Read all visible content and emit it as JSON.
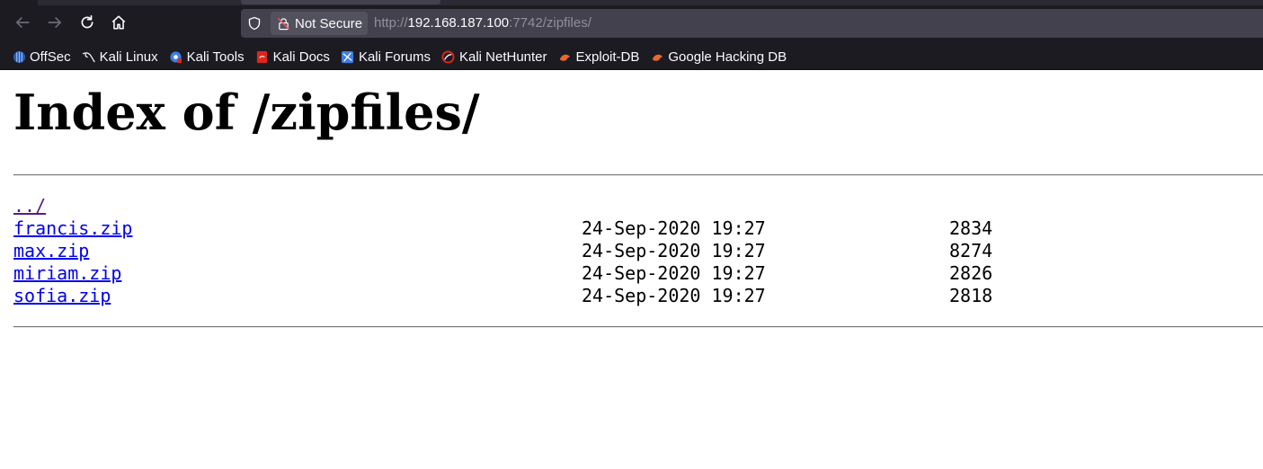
{
  "browser": {
    "security_label": "Not Secure",
    "url_scheme": "http://",
    "url_host": "192.168.187.100",
    "url_rest": ":7742/zipfiles/",
    "bookmarks": [
      {
        "label": "OffSec",
        "icon": "offsec-icon",
        "color": "#3d7ee0"
      },
      {
        "label": "Kali Linux",
        "icon": "kali-dragon-icon",
        "color": "#ffffff"
      },
      {
        "label": "Kali Tools",
        "icon": "kali-tools-icon",
        "color": "#3d7ee0"
      },
      {
        "label": "Kali Docs",
        "icon": "kali-docs-icon",
        "color": "#e0251b"
      },
      {
        "label": "Kali Forums",
        "icon": "kali-forums-icon",
        "color": "#3d7ee0"
      },
      {
        "label": "Kali NetHunter",
        "icon": "nethunter-icon",
        "color": "#e0251b"
      },
      {
        "label": "Exploit-DB",
        "icon": "exploit-db-icon",
        "color": "#e8692a"
      },
      {
        "label": "Google Hacking DB",
        "icon": "ghdb-icon",
        "color": "#e8692a"
      }
    ]
  },
  "page": {
    "title": "Index of /zipfiles/",
    "parent_link": "../",
    "files": [
      {
        "name": "francis.zip",
        "date": "24-Sep-2020 19:27",
        "size": "2834"
      },
      {
        "name": "max.zip",
        "date": "24-Sep-2020 19:27",
        "size": "8274"
      },
      {
        "name": "miriam.zip",
        "date": "24-Sep-2020 19:27",
        "size": "2826"
      },
      {
        "name": "sofia.zip",
        "date": "24-Sep-2020 19:27",
        "size": "2818"
      }
    ]
  }
}
